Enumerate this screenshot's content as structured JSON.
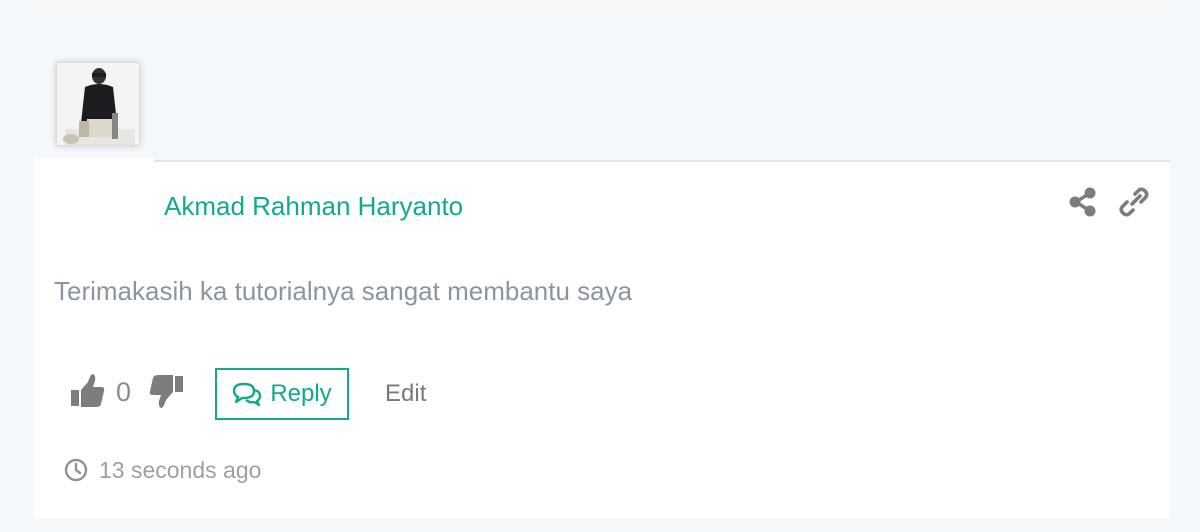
{
  "comment": {
    "author": "Akmad Rahman Haryanto",
    "text": "Terimakasih ka tutorialnya sangat membantu saya",
    "vote_count": "0",
    "reply_label": "Reply",
    "edit_label": "Edit",
    "timestamp": "13 seconds ago"
  },
  "icons": {
    "avatar": "user-avatar",
    "share": "share-icon",
    "link": "link-icon",
    "like": "thumbs-up-icon",
    "dislike": "thumbs-down-icon",
    "reply": "comments-icon",
    "time": "clock-icon"
  },
  "colors": {
    "accent": "#14a88f",
    "text_muted": "#8a95a3",
    "icon_gray": "#7d7d7d"
  }
}
